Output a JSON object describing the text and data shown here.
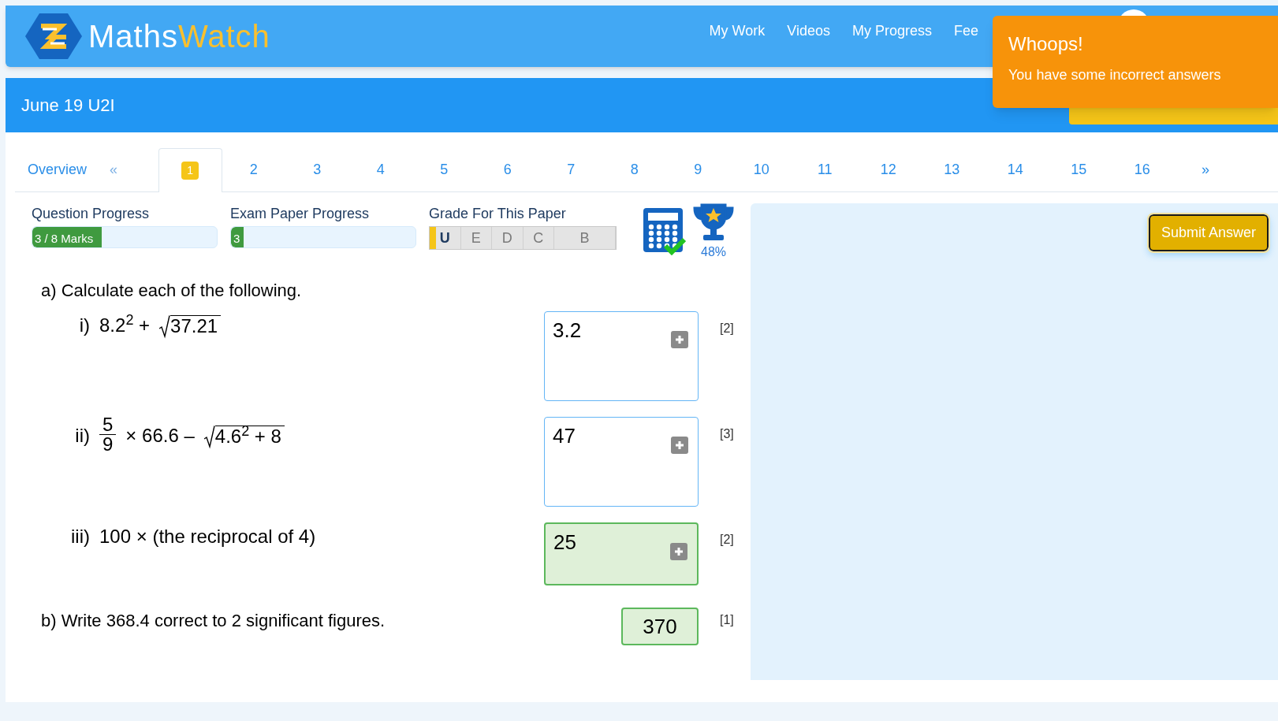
{
  "header": {
    "logo_text": "Maths",
    "logo_text_accent": "Watch",
    "nav": [
      "My Work",
      "Videos",
      "My Progress",
      "Fee"
    ]
  },
  "toast": {
    "title": "Whoops!",
    "message": "You have some incorrect answers"
  },
  "title_bar": {
    "title": "June 19 U2I"
  },
  "tabs": {
    "overview": "Overview",
    "prev": "«",
    "next": "»",
    "items": [
      {
        "label": "1",
        "selected": true
      },
      {
        "label": "2",
        "selected": false
      },
      {
        "label": "3",
        "selected": false
      },
      {
        "label": "4",
        "selected": false
      },
      {
        "label": "5",
        "selected": false
      },
      {
        "label": "6",
        "selected": false
      },
      {
        "label": "7",
        "selected": false
      },
      {
        "label": "8",
        "selected": false
      },
      {
        "label": "9",
        "selected": false
      },
      {
        "label": "10",
        "selected": false
      },
      {
        "label": "11",
        "selected": false
      },
      {
        "label": "12",
        "selected": false
      },
      {
        "label": "13",
        "selected": false
      },
      {
        "label": "14",
        "selected": false
      },
      {
        "label": "15",
        "selected": false
      },
      {
        "label": "16",
        "selected": false
      }
    ]
  },
  "progress": {
    "question": {
      "label": "Question Progress",
      "reading": "3 / 8 Marks",
      "level": 0.375
    },
    "exam": {
      "label": "Exam Paper Progress",
      "reading": "3",
      "level": 0.03
    },
    "grade": {
      "label": "Grade For This Paper",
      "level": 0.035,
      "grades": [
        {
          "label": "U",
          "achieved": true
        },
        {
          "label": "E",
          "achieved": false
        },
        {
          "label": "D",
          "achieved": false
        },
        {
          "label": "C",
          "achieved": false
        },
        {
          "label": "B",
          "achieved": false
        }
      ]
    },
    "percent": "48%"
  },
  "submit_button": "Submit Answer",
  "question": {
    "intro": "a) Calculate each of the following.",
    "parts": [
      {
        "kind": "root",
        "label": "i)",
        "before": "8.2$^{2}$ +",
        "root": "37.21",
        "answer": "3.2",
        "correct": false,
        "marks": "[2]"
      },
      {
        "kind": "fraction",
        "label": "ii)",
        "numerator": "5",
        "denominator": "9",
        "before": "× 66.6 –",
        "root": "4.6$^{2}$ + 8",
        "answer": "47",
        "correct": false,
        "marks": "[3]"
      },
      {
        "kind": "text",
        "label": "iii)",
        "text": "100 × (the reciprocal of 4)",
        "answer": "25",
        "correct": true,
        "marks": "[2]"
      }
    ],
    "b": {
      "text": "b) Write 368.4 correct to 2 significant figures.",
      "answer": "370",
      "correct": true,
      "marks": "[1]"
    }
  }
}
